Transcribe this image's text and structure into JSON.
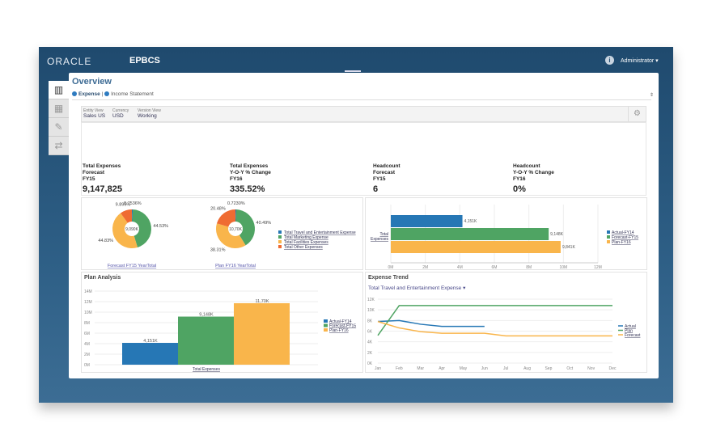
{
  "header": {
    "logo": "ORACLE",
    "app": "EPBCS",
    "user": "Administrator ▾",
    "info_icon": "i"
  },
  "tabs": [
    "chart-icon",
    "table-icon",
    "pen-icon",
    "share-icon"
  ],
  "page": {
    "title": "Overview",
    "breadcrumb": [
      "Expense",
      "Income Statement"
    ],
    "sep": "|"
  },
  "pov": [
    {
      "label": "Entity View",
      "value": "Sales US"
    },
    {
      "label": "Currency",
      "value": "USD"
    },
    {
      "label": "Version View",
      "value": "Working"
    }
  ],
  "kpis": [
    {
      "l1": "Total Expenses",
      "l2": "Forecast",
      "l3": "FY15",
      "value": "9,147,825"
    },
    {
      "l1": "Total Expenses",
      "l2": "Y-O-Y % Change",
      "l3": "FY16",
      "value": "335.52%"
    },
    {
      "l1": "Headcount",
      "l2": "Forecast",
      "l3": "FY15",
      "value": "6"
    },
    {
      "l1": "Headcount",
      "l2": "Y-O-Y % Change",
      "l3": "FY16",
      "value": "0%"
    }
  ],
  "colors": {
    "blue": "#2677b5",
    "green": "#4fa463",
    "yellow": "#f9b54b",
    "orange": "#ef6b32"
  },
  "chart_data": [
    {
      "type": "pie",
      "variant": "donut",
      "title": "Forecast FY15 YearTotal",
      "center": "9,090K",
      "labels": [
        "Total Travel and Entertainment Expense",
        "Total Marketing Expense",
        "Total Facilities Expenses",
        "Total Other Expenses"
      ],
      "values": [
        0.7536,
        44.53,
        44.83,
        9.895
      ],
      "data_labels": [
        "0.7536%",
        "44.53%",
        "44.83%",
        "9.895%"
      ]
    },
    {
      "type": "pie",
      "variant": "donut",
      "title": "Plan FY16 YearTotal",
      "center": "10,70K",
      "labels": [
        "Total Travel and Entertainment Expense",
        "Total Marketing Expense",
        "Total Facilities Expenses",
        "Total Other Expenses"
      ],
      "values": [
        0.723,
        40.49,
        38.31,
        20.48
      ],
      "data_labels": [
        "0.7230%",
        "40.49%",
        "38.31%",
        "20.48%"
      ],
      "legend": [
        "Total Travel and Entertainment Expense",
        "Total Marketing Expense",
        "Total Facilities Expenses",
        "Total Other Expenses"
      ]
    },
    {
      "type": "bar",
      "orientation": "horizontal",
      "categories": [
        "Total Expenses"
      ],
      "series": [
        {
          "name": "Actual-FY14",
          "values": [
            4151000
          ],
          "label": "4,151K"
        },
        {
          "name": "Forecast-FY15",
          "values": [
            9148000
          ],
          "label": "9,148K"
        },
        {
          "name": "Plan-FY16",
          "values": [
            9841000
          ],
          "label": "9,841K"
        }
      ],
      "xlim": [
        0,
        12000000
      ],
      "xticks": [
        "0M",
        "2M",
        "4M",
        "6M",
        "8M",
        "10M",
        "12M"
      ]
    },
    {
      "type": "bar",
      "title": "Plan Analysis",
      "categories": [
        "Total Expenses"
      ],
      "series": [
        {
          "name": "Actual-FY14",
          "values": [
            4151000
          ],
          "label": "4,151K"
        },
        {
          "name": "Forecast-FY15",
          "values": [
            9148000
          ],
          "label": "9,148K"
        },
        {
          "name": "Plan-FY16",
          "values": [
            11700000
          ],
          "label": "11,70K"
        }
      ],
      "ylim": [
        0,
        14000000
      ],
      "yticks": [
        "0M",
        "2M",
        "4M",
        "6M",
        "8M",
        "10M",
        "12M",
        "14M"
      ]
    },
    {
      "type": "line",
      "title": "Expense Trend",
      "selector": "Total Travel and Entertainment Expense",
      "categories": [
        "Jan",
        "Feb",
        "Mar",
        "Apr",
        "May",
        "Jun",
        "Jul",
        "Aug",
        "Sep",
        "Oct",
        "Nov",
        "Dec"
      ],
      "series": [
        {
          "name": "Actual",
          "values": [
            7800,
            8000,
            7300,
            6900,
            6900,
            6900
          ]
        },
        {
          "name": "Plan",
          "values": [
            5200,
            10800,
            10800,
            10800,
            10800,
            10800,
            10800,
            10800,
            10800,
            10800,
            10800,
            10800
          ]
        },
        {
          "name": "Forecast",
          "values": [
            7800,
            6600,
            5900,
            5600,
            5600,
            5600,
            5100,
            5100,
            5100,
            5100,
            5100,
            5100
          ]
        }
      ],
      "ylim": [
        0,
        12000
      ],
      "yticks": [
        "0K",
        "2K",
        "4K",
        "6K",
        "8K",
        "10K",
        "12K"
      ]
    }
  ]
}
